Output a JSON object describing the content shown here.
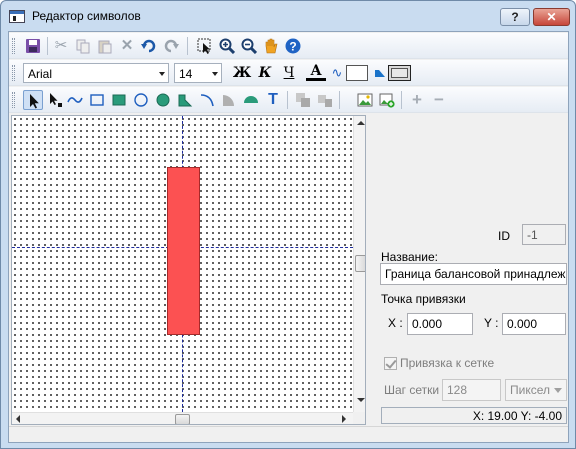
{
  "window": {
    "title": "Редактор символов",
    "help_label": "?",
    "close_label": "✕"
  },
  "toolbar1": {
    "icons": [
      "save-icon",
      "cut-icon",
      "copy-icon",
      "paste-icon",
      "delete-icon",
      "undo-icon",
      "redo-icon",
      "select-area-icon",
      "zoom-in-icon",
      "zoom-out-icon",
      "pan-hand-icon",
      "help-icon"
    ]
  },
  "toolbar2": {
    "font": "Arial",
    "size": "14",
    "bold_label": "Ж",
    "italic_label": "К",
    "underline_label": "Ч",
    "text_color_label": "A",
    "fill_color": "#ffffff"
  },
  "toolbar3": {
    "icons": [
      "pointer-icon",
      "node-pointer-icon",
      "polyline-icon",
      "rectangle-icon",
      "filled-rectangle-icon",
      "ellipse-icon",
      "filled-ellipse-icon",
      "polygon-icon",
      "arc-icon",
      "sector-icon",
      "segment-icon",
      "text-icon",
      "group-icon",
      "ungroup-icon",
      "image-icon",
      "add-image-icon",
      "plus-icon",
      "minus-icon"
    ]
  },
  "props": {
    "id_label": "ID",
    "id_value": "-1",
    "name_label": "Название:",
    "name_value": "Граница балансовой принадлежности",
    "anchor_label": "Точка привязки",
    "x_label": "X :",
    "x_value": "0.000",
    "y_label": "Y :",
    "y_value": "0.000",
    "snap_label": "Привязка к сетке",
    "snap_checked": true,
    "step_label": "Шаг сетки",
    "step_value": "128",
    "unit_value": "Пиксел"
  },
  "status": {
    "coords": "X: 19.00  Y: -4.00"
  },
  "colors": {
    "symbol_fill": "#fc5152",
    "guide": "#1e2c9e",
    "accent": "#3a6fb8"
  }
}
